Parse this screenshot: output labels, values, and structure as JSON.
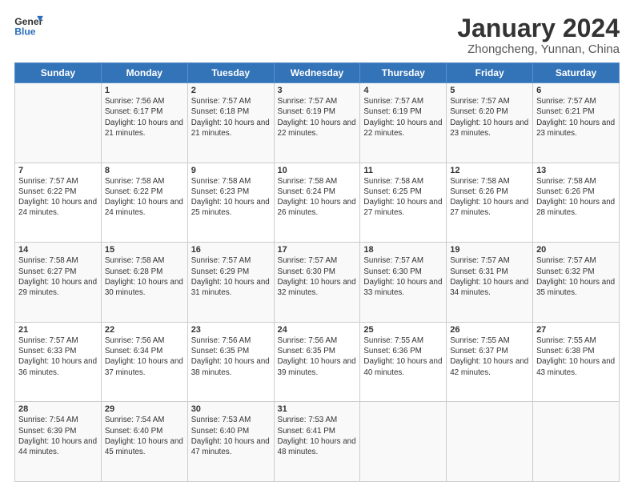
{
  "header": {
    "logo_line1": "General",
    "logo_line2": "Blue",
    "month_year": "January 2024",
    "location": "Zhongcheng, Yunnan, China"
  },
  "days_of_week": [
    "Sunday",
    "Monday",
    "Tuesday",
    "Wednesday",
    "Thursday",
    "Friday",
    "Saturday"
  ],
  "weeks": [
    [
      {
        "day": "",
        "sunrise": "",
        "sunset": "",
        "daylight": ""
      },
      {
        "day": "1",
        "sunrise": "Sunrise: 7:56 AM",
        "sunset": "Sunset: 6:17 PM",
        "daylight": "Daylight: 10 hours and 21 minutes."
      },
      {
        "day": "2",
        "sunrise": "Sunrise: 7:57 AM",
        "sunset": "Sunset: 6:18 PM",
        "daylight": "Daylight: 10 hours and 21 minutes."
      },
      {
        "day": "3",
        "sunrise": "Sunrise: 7:57 AM",
        "sunset": "Sunset: 6:19 PM",
        "daylight": "Daylight: 10 hours and 22 minutes."
      },
      {
        "day": "4",
        "sunrise": "Sunrise: 7:57 AM",
        "sunset": "Sunset: 6:19 PM",
        "daylight": "Daylight: 10 hours and 22 minutes."
      },
      {
        "day": "5",
        "sunrise": "Sunrise: 7:57 AM",
        "sunset": "Sunset: 6:20 PM",
        "daylight": "Daylight: 10 hours and 23 minutes."
      },
      {
        "day": "6",
        "sunrise": "Sunrise: 7:57 AM",
        "sunset": "Sunset: 6:21 PM",
        "daylight": "Daylight: 10 hours and 23 minutes."
      }
    ],
    [
      {
        "day": "7",
        "sunrise": "Sunrise: 7:57 AM",
        "sunset": "Sunset: 6:22 PM",
        "daylight": "Daylight: 10 hours and 24 minutes."
      },
      {
        "day": "8",
        "sunrise": "Sunrise: 7:58 AM",
        "sunset": "Sunset: 6:22 PM",
        "daylight": "Daylight: 10 hours and 24 minutes."
      },
      {
        "day": "9",
        "sunrise": "Sunrise: 7:58 AM",
        "sunset": "Sunset: 6:23 PM",
        "daylight": "Daylight: 10 hours and 25 minutes."
      },
      {
        "day": "10",
        "sunrise": "Sunrise: 7:58 AM",
        "sunset": "Sunset: 6:24 PM",
        "daylight": "Daylight: 10 hours and 26 minutes."
      },
      {
        "day": "11",
        "sunrise": "Sunrise: 7:58 AM",
        "sunset": "Sunset: 6:25 PM",
        "daylight": "Daylight: 10 hours and 27 minutes."
      },
      {
        "day": "12",
        "sunrise": "Sunrise: 7:58 AM",
        "sunset": "Sunset: 6:26 PM",
        "daylight": "Daylight: 10 hours and 27 minutes."
      },
      {
        "day": "13",
        "sunrise": "Sunrise: 7:58 AM",
        "sunset": "Sunset: 6:26 PM",
        "daylight": "Daylight: 10 hours and 28 minutes."
      }
    ],
    [
      {
        "day": "14",
        "sunrise": "Sunrise: 7:58 AM",
        "sunset": "Sunset: 6:27 PM",
        "daylight": "Daylight: 10 hours and 29 minutes."
      },
      {
        "day": "15",
        "sunrise": "Sunrise: 7:58 AM",
        "sunset": "Sunset: 6:28 PM",
        "daylight": "Daylight: 10 hours and 30 minutes."
      },
      {
        "day": "16",
        "sunrise": "Sunrise: 7:57 AM",
        "sunset": "Sunset: 6:29 PM",
        "daylight": "Daylight: 10 hours and 31 minutes."
      },
      {
        "day": "17",
        "sunrise": "Sunrise: 7:57 AM",
        "sunset": "Sunset: 6:30 PM",
        "daylight": "Daylight: 10 hours and 32 minutes."
      },
      {
        "day": "18",
        "sunrise": "Sunrise: 7:57 AM",
        "sunset": "Sunset: 6:30 PM",
        "daylight": "Daylight: 10 hours and 33 minutes."
      },
      {
        "day": "19",
        "sunrise": "Sunrise: 7:57 AM",
        "sunset": "Sunset: 6:31 PM",
        "daylight": "Daylight: 10 hours and 34 minutes."
      },
      {
        "day": "20",
        "sunrise": "Sunrise: 7:57 AM",
        "sunset": "Sunset: 6:32 PM",
        "daylight": "Daylight: 10 hours and 35 minutes."
      }
    ],
    [
      {
        "day": "21",
        "sunrise": "Sunrise: 7:57 AM",
        "sunset": "Sunset: 6:33 PM",
        "daylight": "Daylight: 10 hours and 36 minutes."
      },
      {
        "day": "22",
        "sunrise": "Sunrise: 7:56 AM",
        "sunset": "Sunset: 6:34 PM",
        "daylight": "Daylight: 10 hours and 37 minutes."
      },
      {
        "day": "23",
        "sunrise": "Sunrise: 7:56 AM",
        "sunset": "Sunset: 6:35 PM",
        "daylight": "Daylight: 10 hours and 38 minutes."
      },
      {
        "day": "24",
        "sunrise": "Sunrise: 7:56 AM",
        "sunset": "Sunset: 6:35 PM",
        "daylight": "Daylight: 10 hours and 39 minutes."
      },
      {
        "day": "25",
        "sunrise": "Sunrise: 7:55 AM",
        "sunset": "Sunset: 6:36 PM",
        "daylight": "Daylight: 10 hours and 40 minutes."
      },
      {
        "day": "26",
        "sunrise": "Sunrise: 7:55 AM",
        "sunset": "Sunset: 6:37 PM",
        "daylight": "Daylight: 10 hours and 42 minutes."
      },
      {
        "day": "27",
        "sunrise": "Sunrise: 7:55 AM",
        "sunset": "Sunset: 6:38 PM",
        "daylight": "Daylight: 10 hours and 43 minutes."
      }
    ],
    [
      {
        "day": "28",
        "sunrise": "Sunrise: 7:54 AM",
        "sunset": "Sunset: 6:39 PM",
        "daylight": "Daylight: 10 hours and 44 minutes."
      },
      {
        "day": "29",
        "sunrise": "Sunrise: 7:54 AM",
        "sunset": "Sunset: 6:40 PM",
        "daylight": "Daylight: 10 hours and 45 minutes."
      },
      {
        "day": "30",
        "sunrise": "Sunrise: 7:53 AM",
        "sunset": "Sunset: 6:40 PM",
        "daylight": "Daylight: 10 hours and 47 minutes."
      },
      {
        "day": "31",
        "sunrise": "Sunrise: 7:53 AM",
        "sunset": "Sunset: 6:41 PM",
        "daylight": "Daylight: 10 hours and 48 minutes."
      },
      {
        "day": "",
        "sunrise": "",
        "sunset": "",
        "daylight": ""
      },
      {
        "day": "",
        "sunrise": "",
        "sunset": "",
        "daylight": ""
      },
      {
        "day": "",
        "sunrise": "",
        "sunset": "",
        "daylight": ""
      }
    ]
  ]
}
